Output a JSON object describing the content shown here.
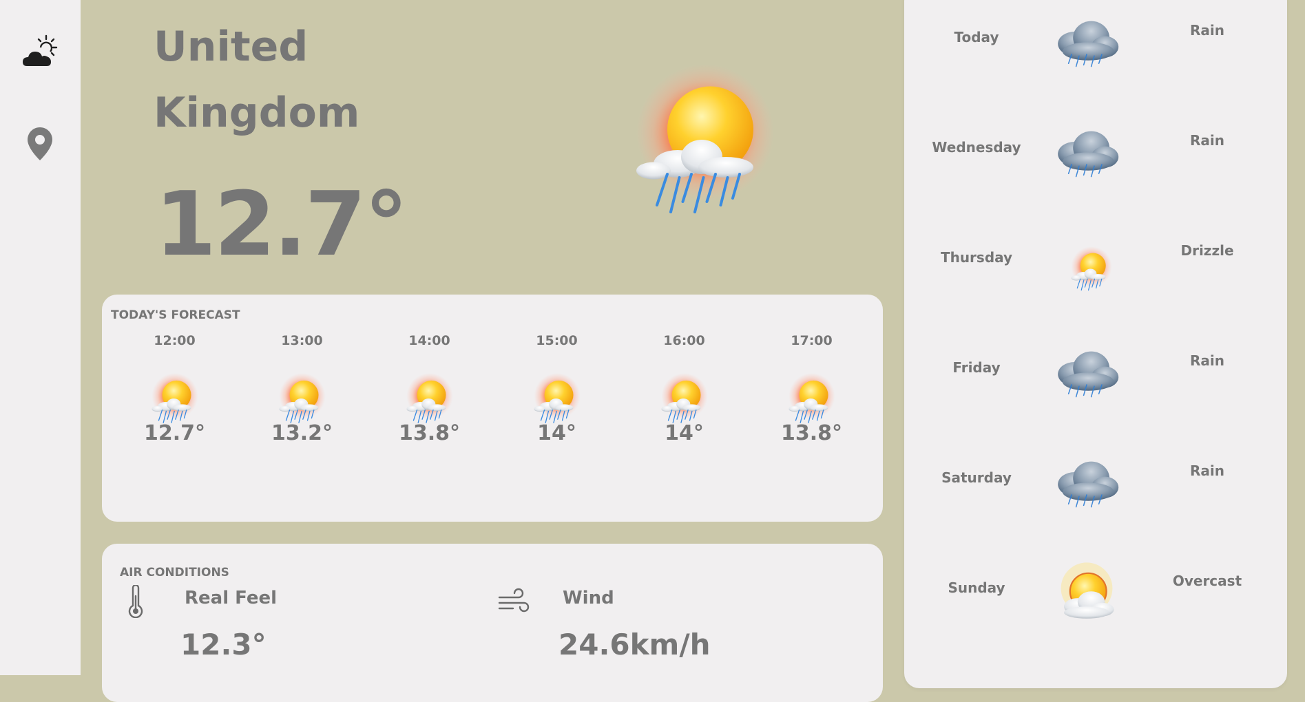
{
  "sidebar": {
    "items": [
      {
        "icon": "weather-logo-icon"
      },
      {
        "icon": "location-pin-icon"
      }
    ]
  },
  "current": {
    "city": "United Kingdom",
    "temperature": "12.7°",
    "icon": "sun-cloud-rain-icon"
  },
  "today_forecast": {
    "title": "TODAY'S FORECAST",
    "hours": [
      {
        "time": "12:00",
        "temp": "12.7°",
        "icon": "sun-cloud-rain-icon"
      },
      {
        "time": "13:00",
        "temp": "13.2°",
        "icon": "sun-cloud-rain-icon"
      },
      {
        "time": "14:00",
        "temp": "13.8°",
        "icon": "sun-cloud-rain-icon"
      },
      {
        "time": "15:00",
        "temp": "14°",
        "icon": "sun-cloud-rain-icon"
      },
      {
        "time": "16:00",
        "temp": "14°",
        "icon": "sun-cloud-rain-icon"
      },
      {
        "time": "17:00",
        "temp": "13.8°",
        "icon": "sun-cloud-rain-icon"
      }
    ]
  },
  "air_conditions": {
    "title": "AIR CONDITIONS",
    "real_feel": {
      "label": "Real Feel",
      "value": "12.3°",
      "icon": "thermometer-icon"
    },
    "wind": {
      "label": "Wind",
      "value": "24.6km/h",
      "icon": "wind-icon"
    }
  },
  "week_forecast": [
    {
      "day": "Today",
      "condition": "Rain",
      "icon": "rain-cloud-icon"
    },
    {
      "day": "Wednesday",
      "condition": "Rain",
      "icon": "rain-cloud-icon"
    },
    {
      "day": "Thursday",
      "condition": "Drizzle",
      "icon": "sun-cloud-rain-icon"
    },
    {
      "day": "Friday",
      "condition": "Rain",
      "icon": "rain-cloud-icon"
    },
    {
      "day": "Saturday",
      "condition": "Rain",
      "icon": "rain-cloud-icon"
    },
    {
      "day": "Sunday",
      "condition": "Overcast",
      "icon": "overcast-icon"
    }
  ],
  "colors": {
    "background": "#cbc8aa",
    "panel": "#f1eff0",
    "text": "#767676"
  }
}
